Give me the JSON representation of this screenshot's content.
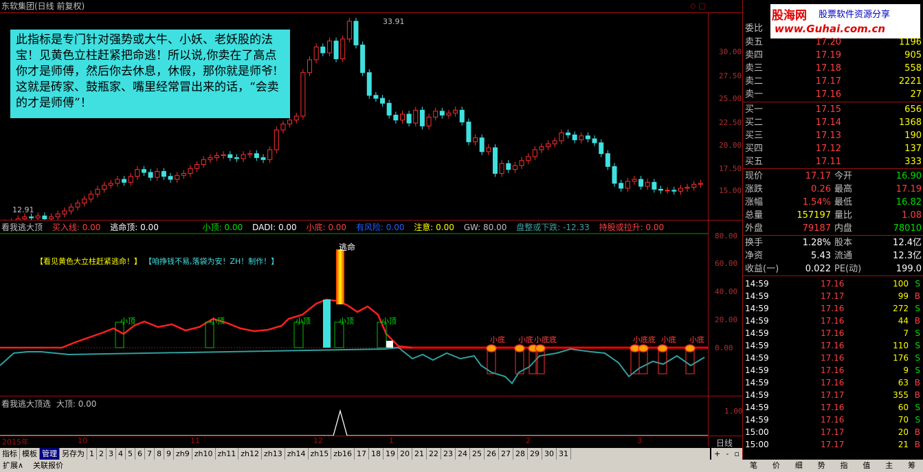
{
  "window": {
    "title": "东软集团(日线 前复权)",
    "corner_icons": "◇ □"
  },
  "logo": {
    "brand": "股海网",
    "slogan": "股票软件资源分享",
    "url": "www.Guhai.com.cn"
  },
  "main_chart": {
    "y_ticks": [
      "30.00",
      "27.50",
      "25.00",
      "22.50",
      "20.00",
      "17.50",
      "15.00"
    ],
    "high_label": "33.91",
    "low_label": "12.91",
    "note": "此指标是专门针对强势或大牛、小妖、老妖股的法宝！见黄色立柱赶紧把命逃！所以说,你卖在了高点你才是师傅，然后你去休息，休假，那你就是师爷!这就是砖家、鼓瓶家、嘴里经常冒出来的话，“会卖的才是师傅”！"
  },
  "indicator1": {
    "name": "看我逃大顶",
    "fields": [
      {
        "label": "买入线: 0.00",
        "color": "#ff4040"
      },
      {
        "label": "逃命顶: 0.00",
        "color": "#ffffff"
      },
      {
        "label": "小顶: 0.00",
        "color": "#00e000"
      },
      {
        "label": "DADI: 0.00",
        "color": "#ffffff"
      },
      {
        "label": "小底: 0.00",
        "color": "#ff4040"
      },
      {
        "label": "有风险: 0.00",
        "color": "#2060ff"
      },
      {
        "label": "注意: 0.00",
        "color": "#ffff00"
      },
      {
        "label": "GW: 80.00",
        "color": "#c0c0c0"
      },
      {
        "label": "盘整或下跌: -12.33",
        "color": "#40a0a0"
      },
      {
        "label": "持股或拉升: 0.00",
        "color": "#ff4040"
      }
    ],
    "banner1": "【看见黄色大立柱赶紧逃命！】",
    "banner2": "【咱挣钱不易,落袋为安！ZH！制作！】",
    "y_ticks": [
      "80.00",
      "60.00",
      "40.00",
      "20.00",
      "0.00"
    ],
    "escape_label": "逃命",
    "small_top": "小顶",
    "small_bottom": "小底",
    "small_bottom_dense": "小底底",
    "small_bottom_pair": "小底底"
  },
  "indicator2": {
    "name": "看我逃大顶选",
    "field": "大顶: 0.00",
    "y_tick": "1.00"
  },
  "time_axis": {
    "labels": [
      "2015年",
      "10",
      "11",
      "12",
      "1",
      "2",
      "3"
    ],
    "period": "日线"
  },
  "tabs": [
    "指标",
    "模板",
    "管理",
    "另存为",
    "1",
    "2",
    "3",
    "4",
    "5",
    "6",
    "7",
    "8",
    "9",
    "zh9",
    "zh10",
    "zh11",
    "zh12",
    "zh13",
    "zh14",
    "zh15",
    "zb16",
    "17",
    "18",
    "19",
    "20",
    "21",
    "22",
    "23",
    "24",
    "25",
    "26",
    "27",
    "28",
    "29",
    "30",
    "31"
  ],
  "bottom": {
    "expand": "扩展∧",
    "related": "关联报价",
    "right_tabs": [
      "笔",
      "价",
      "细",
      "势",
      "指",
      "值",
      "主",
      "筹"
    ]
  },
  "order_book": {
    "header": "委比",
    "asks": [
      {
        "label": "卖五",
        "price": "17.20",
        "vol": "1196"
      },
      {
        "label": "卖四",
        "price": "17.19",
        "vol": "905"
      },
      {
        "label": "卖三",
        "price": "17.18",
        "vol": "558"
      },
      {
        "label": "卖二",
        "price": "17.17",
        "vol": "2221"
      },
      {
        "label": "卖一",
        "price": "17.16",
        "vol": "27"
      }
    ],
    "bids": [
      {
        "label": "买一",
        "price": "17.15",
        "vol": "656"
      },
      {
        "label": "买二",
        "price": "17.14",
        "vol": "1368"
      },
      {
        "label": "买三",
        "price": "17.13",
        "vol": "190"
      },
      {
        "label": "买四",
        "price": "17.12",
        "vol": "137"
      },
      {
        "label": "买五",
        "price": "17.11",
        "vol": "333"
      }
    ]
  },
  "quote": [
    {
      "l1": "现价",
      "v1": "17.17",
      "c1": "red",
      "l2": "今开",
      "v2": "16.90",
      "c2": "green"
    },
    {
      "l1": "涨跌",
      "v1": "0.26",
      "c1": "red",
      "l2": "最高",
      "v2": "17.19",
      "c2": "red"
    },
    {
      "l1": "涨幅",
      "v1": "1.54%",
      "c1": "red",
      "l2": "最低",
      "v2": "16.82",
      "c2": "green"
    },
    {
      "l1": "总量",
      "v1": "157197",
      "c1": "yellow",
      "l2": "量比",
      "v2": "1.08",
      "c2": "red"
    },
    {
      "l1": "外盘",
      "v1": "79187",
      "c1": "red",
      "l2": "内盘",
      "v2": "78010",
      "c2": "green"
    }
  ],
  "fundamentals": [
    {
      "l1": "换手",
      "v1": "1.28%",
      "l2": "股本",
      "v2": "12.4亿"
    },
    {
      "l1": "净资",
      "v1": "5.43",
      "l2": "流通",
      "v2": "12.3亿"
    },
    {
      "l1": "收益(一)",
      "v1": "0.022",
      "l2": "PE(动)",
      "v2": "199.0"
    }
  ],
  "ticks": [
    {
      "t": "14:59",
      "p": "17.16",
      "v": "100",
      "bs": "S"
    },
    {
      "t": "14:59",
      "p": "17.17",
      "v": "99",
      "bs": "B"
    },
    {
      "t": "14:59",
      "p": "17.16",
      "v": "272",
      "bs": "S"
    },
    {
      "t": "14:59",
      "p": "17.16",
      "v": "44",
      "bs": "B"
    },
    {
      "t": "14:59",
      "p": "17.16",
      "v": "7",
      "bs": "S"
    },
    {
      "t": "14:59",
      "p": "17.16",
      "v": "110",
      "bs": "S"
    },
    {
      "t": "14:59",
      "p": "17.16",
      "v": "176",
      "bs": "S"
    },
    {
      "t": "14:59",
      "p": "17.16",
      "v": "9",
      "bs": "S"
    },
    {
      "t": "14:59",
      "p": "17.16",
      "v": "63",
      "bs": "B"
    },
    {
      "t": "14:59",
      "p": "17.17",
      "v": "355",
      "bs": "B"
    },
    {
      "t": "14:59",
      "p": "17.16",
      "v": "60",
      "bs": "S"
    },
    {
      "t": "14:59",
      "p": "17.16",
      "v": "70",
      "bs": "S"
    },
    {
      "t": "15:00",
      "p": "17.17",
      "v": "20",
      "bs": "B"
    },
    {
      "t": "15:00",
      "p": "17.17",
      "v": "21",
      "bs": "B"
    }
  ],
  "chart_data": {
    "type": "candlestick",
    "price_range": [
      12.91,
      33.91
    ],
    "ylim": [
      13.5,
      34.5
    ],
    "closes": [
      13.2,
      13.3,
      13.6,
      13.8,
      13.7,
      13.9,
      13.6,
      13.8,
      14.1,
      14.4,
      14.8,
      15.2,
      15.6,
      16.1,
      16.6,
      17.0,
      17.2,
      17.6,
      17.3,
      17.9,
      18.6,
      18.3,
      17.8,
      18.4,
      17.9,
      17.6,
      18.0,
      18.2,
      18.7,
      19.1,
      19.6,
      19.8,
      20.0,
      20.1,
      19.8,
      19.7,
      20.1,
      20.2,
      19.8,
      19.6,
      20.6,
      22.6,
      23.2,
      23.6,
      24.0,
      28.4,
      29.7,
      31.0,
      30.4,
      31.6,
      29.8,
      31.8,
      33.6,
      31.2,
      28.4,
      26.1,
      25.8,
      25.3,
      24.1,
      23.6,
      24.2,
      23.3,
      24.6,
      23.0,
      23.9,
      24.5,
      24.1,
      24.3,
      24.6,
      23.4,
      21.4,
      21.8,
      20.4,
      20.8,
      18.2,
      19.2,
      18.6,
      19.0,
      19.5,
      19.9,
      20.6,
      20.9,
      21.2,
      21.5,
      22.3,
      22.1,
      21.6,
      22.0,
      21.7,
      21.3,
      20.2,
      18.9,
      17.2,
      16.7,
      17.4,
      17.6,
      16.9,
      17.3,
      16.6,
      16.5,
      16.5,
      16.4,
      16.7,
      16.8,
      17.1,
      17.2
    ]
  }
}
